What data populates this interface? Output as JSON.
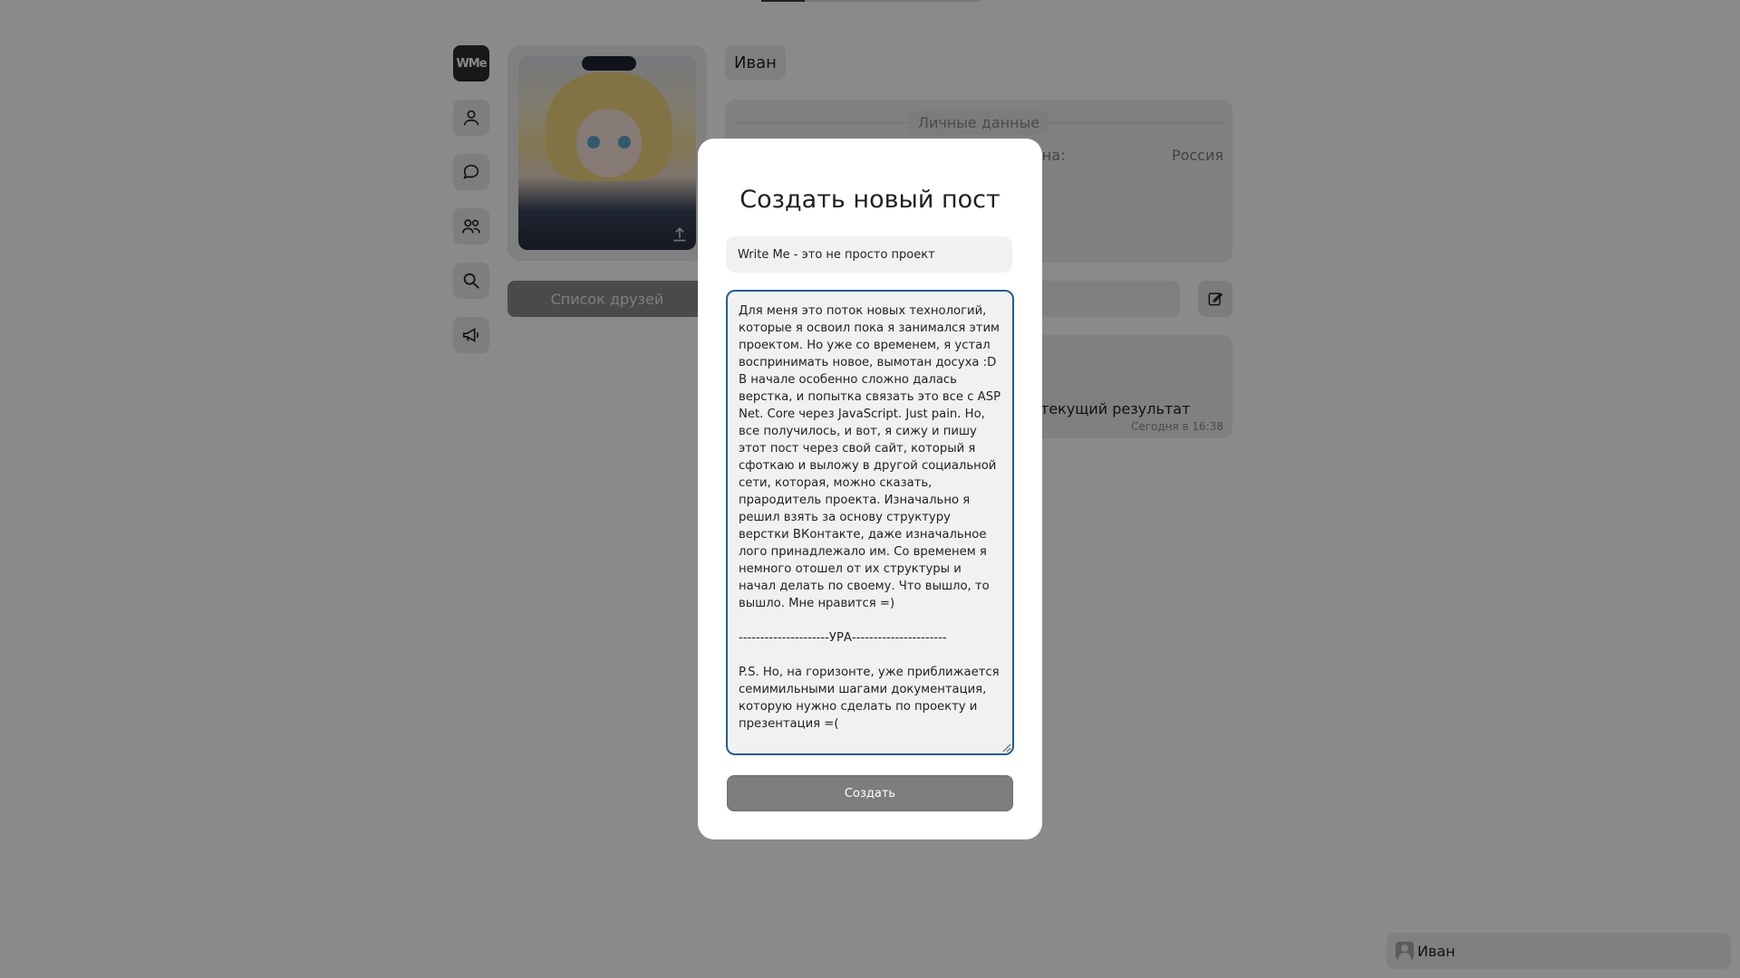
{
  "brand": {
    "logo_text": "WMe"
  },
  "nav": {
    "items": [
      {
        "icon": "logo-icon"
      },
      {
        "icon": "profile-icon"
      },
      {
        "icon": "chat-icon"
      },
      {
        "icon": "friends-icon"
      },
      {
        "icon": "search-icon"
      },
      {
        "icon": "megaphone-icon"
      }
    ]
  },
  "profile": {
    "name": "Иван",
    "friends_button": "Список друзей",
    "personal_section_title": "Личные данные",
    "country_label": "ана:",
    "country_value": "Россия"
  },
  "feed": {
    "post_title_partial": "текущий результат",
    "post_date": "Сегодня в 16:38"
  },
  "footer_user": {
    "name": "Иван"
  },
  "modal": {
    "title": "Создать новый пост",
    "title_value": "Write Me - это не просто проект",
    "body_value": "Для меня это поток новых технологий, которые я освоил пока я занимался этим проектом. Но уже со временем, я устал воспринимать новое, вымотан досуха :D В начале особенно сложно далась верстка, и попытка связать это все с ASP Net. Core через JavaScript. Just pain. Но, все получилось, и вот, я сижу и пишу этот пост через свой сайт, который я сфоткаю и выложу в другой социальной сети, которая, можно сказать, прародитель проекта. Изначально я решил взять за основу структуру верстки ВКонтакте, даже изначальное лого принадлежало им. Со временем я немного отошел от их структуры и начал делать по своему. Что вышло, то вышло. Мне нравится =)\n\n---------------------УРА----------------------\n\nP.S. Но, на горизонте, уже приближается семимильными шагами документация, которую нужно сделать по проекту и презентация =(",
    "submit_label": "Создать"
  }
}
